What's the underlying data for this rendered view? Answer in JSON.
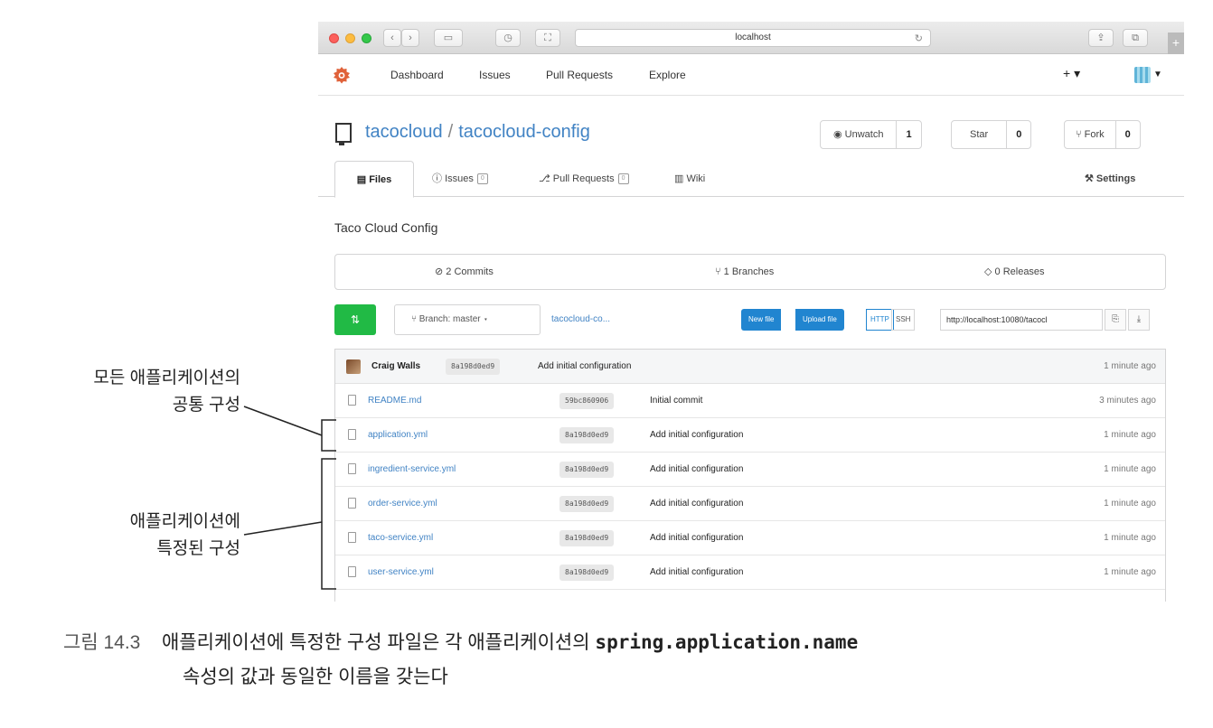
{
  "browser": {
    "url": "localhost"
  },
  "header": {
    "nav": [
      "Dashboard",
      "Issues",
      "Pull Requests",
      "Explore"
    ],
    "create_label": "+ ▾"
  },
  "repo": {
    "owner": "tacocloud",
    "separator": "/",
    "name": "tacocloud-config",
    "watch_label": "Unwatch",
    "watch_count": "1",
    "star_label": "Star",
    "star_count": "0",
    "fork_label": "Fork",
    "fork_count": "0",
    "description": "Taco Cloud Config"
  },
  "tabs": {
    "files": "Files",
    "issues": "Issues",
    "issues_count": "0",
    "pulls": "Pull Requests",
    "pulls_count": "0",
    "wiki": "Wiki",
    "settings": "Settings"
  },
  "stats": {
    "commits": "2 Commits",
    "branches": "1 Branches",
    "releases": "0 Releases"
  },
  "toolbar": {
    "branch": "Branch: master",
    "path": "tacocloud-co...",
    "new_file": "New file",
    "upload_file": "Upload file",
    "http": "HTTP",
    "ssh": "SSH",
    "clone_url": "http://localhost:10080/tacocl"
  },
  "latest_commit": {
    "author": "Craig Walls",
    "sha": "8a198d0ed9",
    "message": "Add initial configuration",
    "age": "1 minute ago"
  },
  "files": [
    {
      "name": "README.md",
      "sha": "59bc860906",
      "message": "Initial commit",
      "age": "3 minutes ago"
    },
    {
      "name": "application.yml",
      "sha": "8a198d0ed9",
      "message": "Add initial configuration",
      "age": "1 minute ago"
    },
    {
      "name": "ingredient-service.yml",
      "sha": "8a198d0ed9",
      "message": "Add initial configuration",
      "age": "1 minute ago"
    },
    {
      "name": "order-service.yml",
      "sha": "8a198d0ed9",
      "message": "Add initial configuration",
      "age": "1 minute ago"
    },
    {
      "name": "taco-service.yml",
      "sha": "8a198d0ed9",
      "message": "Add initial configuration",
      "age": "1 minute ago"
    },
    {
      "name": "user-service.yml",
      "sha": "8a198d0ed9",
      "message": "Add initial configuration",
      "age": "1 minute ago"
    }
  ],
  "annotations": {
    "common_line1": "모든 애플리케이션의",
    "common_line2": "공통 구성",
    "specific_line1": "애플리케이션에",
    "specific_line2": "특정된 구성"
  },
  "caption": {
    "figure": "그림 14.3",
    "text_before": "애플리케이션에 특정한 구성 파일은 각 애플리케이션의",
    "code": "spring.application.name",
    "line2": "속성의 값과 동일한 이름을 갖는다"
  },
  "colors": {
    "link": "#4183c4",
    "primary_button": "#2185d0",
    "clone_button": "#21ba45",
    "logo": "#e0623a"
  }
}
